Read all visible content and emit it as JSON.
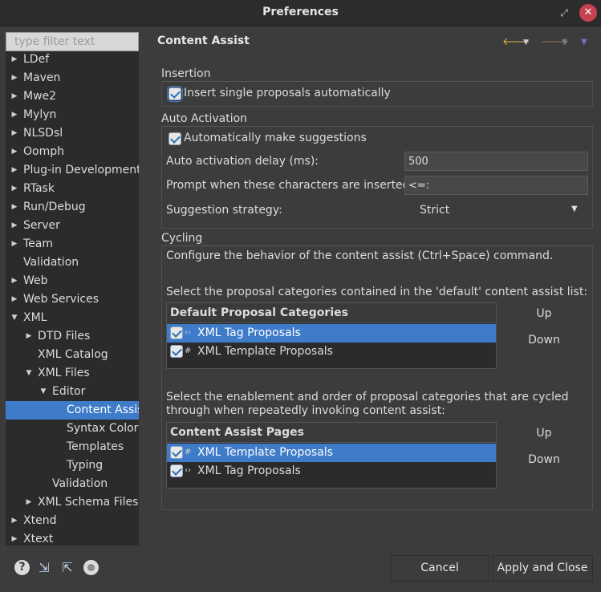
{
  "window": {
    "title": "Preferences",
    "restore_glyph": "⤢",
    "close_glyph": "✕"
  },
  "filter": {
    "placeholder": "type filter text"
  },
  "tree": [
    {
      "label": "LDef",
      "indent": 0,
      "arrow": "▶"
    },
    {
      "label": "Maven",
      "indent": 0,
      "arrow": "▶"
    },
    {
      "label": "Mwe2",
      "indent": 0,
      "arrow": "▶"
    },
    {
      "label": "Mylyn",
      "indent": 0,
      "arrow": "▶"
    },
    {
      "label": "NLSDsl",
      "indent": 0,
      "arrow": "▶"
    },
    {
      "label": "Oomph",
      "indent": 0,
      "arrow": "▶"
    },
    {
      "label": "Plug-in Development",
      "indent": 0,
      "arrow": "▶"
    },
    {
      "label": "RTask",
      "indent": 0,
      "arrow": "▶"
    },
    {
      "label": "Run/Debug",
      "indent": 0,
      "arrow": "▶"
    },
    {
      "label": "Server",
      "indent": 0,
      "arrow": "▶"
    },
    {
      "label": "Team",
      "indent": 0,
      "arrow": "▶"
    },
    {
      "label": "Validation",
      "indent": 0,
      "arrow": ""
    },
    {
      "label": "Web",
      "indent": 0,
      "arrow": "▶"
    },
    {
      "label": "Web Services",
      "indent": 0,
      "arrow": "▶"
    },
    {
      "label": "XML",
      "indent": 0,
      "arrow": "▼"
    },
    {
      "label": "DTD Files",
      "indent": 1,
      "arrow": "▶"
    },
    {
      "label": "XML Catalog",
      "indent": 1,
      "arrow": ""
    },
    {
      "label": "XML Files",
      "indent": 1,
      "arrow": "▼"
    },
    {
      "label": "Editor",
      "indent": 2,
      "arrow": "▼"
    },
    {
      "label": "Content Assist",
      "indent": 3,
      "arrow": "",
      "selected": true
    },
    {
      "label": "Syntax Coloring",
      "indent": 3,
      "arrow": ""
    },
    {
      "label": "Templates",
      "indent": 3,
      "arrow": ""
    },
    {
      "label": "Typing",
      "indent": 3,
      "arrow": ""
    },
    {
      "label": "Validation",
      "indent": 2,
      "arrow": ""
    },
    {
      "label": "XML Schema Files",
      "indent": 1,
      "arrow": "▶"
    },
    {
      "label": "Xtend",
      "indent": 0,
      "arrow": "▶"
    },
    {
      "label": "Xtext",
      "indent": 0,
      "arrow": "▶"
    }
  ],
  "bottom_icons": {
    "help": "?",
    "import": "⇲",
    "export": "⇱"
  },
  "page": {
    "title": "Content Assist",
    "nav": {
      "back": "🡐",
      "forward": "🡒",
      "menu_caret": "▼"
    }
  },
  "insertion": {
    "group_label": "Insertion",
    "insert_single": "Insert single proposals automatically"
  },
  "auto_activation": {
    "group_label": "Auto Activation",
    "make_suggestions": "Automatically make suggestions",
    "delay_label": "Auto activation delay (ms):",
    "delay_value": "500",
    "prompt_label": "Prompt when these characters are inserted:",
    "prompt_value": "<=:",
    "strategy_label": "Suggestion strategy:",
    "strategy_value": "Strict",
    "caret": "▼"
  },
  "cycling": {
    "group_label": "Cycling",
    "description": "Configure the behavior of the content assist (Ctrl+Space) command.",
    "default_list_label": "Select the proposal categories contained in the 'default' content assist list:",
    "default_table": {
      "header": "Default Proposal Categories",
      "rows": [
        {
          "icon": "‹›",
          "label": "XML Tag Proposals",
          "selected": true
        },
        {
          "icon": "#",
          "label": "XML Template Proposals",
          "selected": false
        }
      ]
    },
    "order_label_1": "Select the enablement and order of proposal categories that are cycled",
    "order_label_2": "through when repeatedly invoking content assist:",
    "pages_table": {
      "header": "Content Assist Pages",
      "rows": [
        {
          "icon": "#",
          "label": "XML Template Proposals",
          "selected": true
        },
        {
          "icon": "‹›",
          "label": "XML Tag Proposals",
          "selected": false
        }
      ]
    },
    "up": "Up",
    "down": "Down"
  },
  "buttons": {
    "cancel": "Cancel",
    "apply_close": "Apply and Close"
  }
}
